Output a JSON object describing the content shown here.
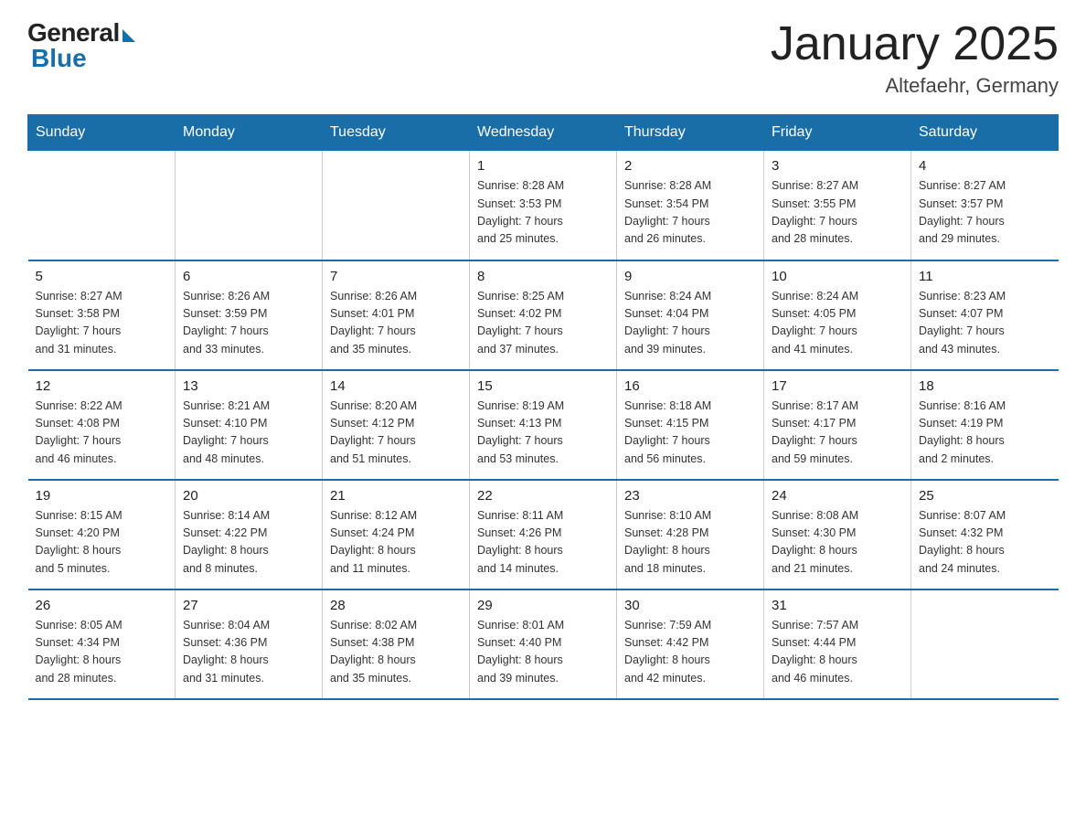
{
  "logo": {
    "general": "General",
    "blue": "Blue"
  },
  "title": "January 2025",
  "location": "Altefaehr, Germany",
  "weekdays": [
    "Sunday",
    "Monday",
    "Tuesday",
    "Wednesday",
    "Thursday",
    "Friday",
    "Saturday"
  ],
  "weeks": [
    [
      {
        "day": "",
        "info": ""
      },
      {
        "day": "",
        "info": ""
      },
      {
        "day": "",
        "info": ""
      },
      {
        "day": "1",
        "info": "Sunrise: 8:28 AM\nSunset: 3:53 PM\nDaylight: 7 hours\nand 25 minutes."
      },
      {
        "day": "2",
        "info": "Sunrise: 8:28 AM\nSunset: 3:54 PM\nDaylight: 7 hours\nand 26 minutes."
      },
      {
        "day": "3",
        "info": "Sunrise: 8:27 AM\nSunset: 3:55 PM\nDaylight: 7 hours\nand 28 minutes."
      },
      {
        "day": "4",
        "info": "Sunrise: 8:27 AM\nSunset: 3:57 PM\nDaylight: 7 hours\nand 29 minutes."
      }
    ],
    [
      {
        "day": "5",
        "info": "Sunrise: 8:27 AM\nSunset: 3:58 PM\nDaylight: 7 hours\nand 31 minutes."
      },
      {
        "day": "6",
        "info": "Sunrise: 8:26 AM\nSunset: 3:59 PM\nDaylight: 7 hours\nand 33 minutes."
      },
      {
        "day": "7",
        "info": "Sunrise: 8:26 AM\nSunset: 4:01 PM\nDaylight: 7 hours\nand 35 minutes."
      },
      {
        "day": "8",
        "info": "Sunrise: 8:25 AM\nSunset: 4:02 PM\nDaylight: 7 hours\nand 37 minutes."
      },
      {
        "day": "9",
        "info": "Sunrise: 8:24 AM\nSunset: 4:04 PM\nDaylight: 7 hours\nand 39 minutes."
      },
      {
        "day": "10",
        "info": "Sunrise: 8:24 AM\nSunset: 4:05 PM\nDaylight: 7 hours\nand 41 minutes."
      },
      {
        "day": "11",
        "info": "Sunrise: 8:23 AM\nSunset: 4:07 PM\nDaylight: 7 hours\nand 43 minutes."
      }
    ],
    [
      {
        "day": "12",
        "info": "Sunrise: 8:22 AM\nSunset: 4:08 PM\nDaylight: 7 hours\nand 46 minutes."
      },
      {
        "day": "13",
        "info": "Sunrise: 8:21 AM\nSunset: 4:10 PM\nDaylight: 7 hours\nand 48 minutes."
      },
      {
        "day": "14",
        "info": "Sunrise: 8:20 AM\nSunset: 4:12 PM\nDaylight: 7 hours\nand 51 minutes."
      },
      {
        "day": "15",
        "info": "Sunrise: 8:19 AM\nSunset: 4:13 PM\nDaylight: 7 hours\nand 53 minutes."
      },
      {
        "day": "16",
        "info": "Sunrise: 8:18 AM\nSunset: 4:15 PM\nDaylight: 7 hours\nand 56 minutes."
      },
      {
        "day": "17",
        "info": "Sunrise: 8:17 AM\nSunset: 4:17 PM\nDaylight: 7 hours\nand 59 minutes."
      },
      {
        "day": "18",
        "info": "Sunrise: 8:16 AM\nSunset: 4:19 PM\nDaylight: 8 hours\nand 2 minutes."
      }
    ],
    [
      {
        "day": "19",
        "info": "Sunrise: 8:15 AM\nSunset: 4:20 PM\nDaylight: 8 hours\nand 5 minutes."
      },
      {
        "day": "20",
        "info": "Sunrise: 8:14 AM\nSunset: 4:22 PM\nDaylight: 8 hours\nand 8 minutes."
      },
      {
        "day": "21",
        "info": "Sunrise: 8:12 AM\nSunset: 4:24 PM\nDaylight: 8 hours\nand 11 minutes."
      },
      {
        "day": "22",
        "info": "Sunrise: 8:11 AM\nSunset: 4:26 PM\nDaylight: 8 hours\nand 14 minutes."
      },
      {
        "day": "23",
        "info": "Sunrise: 8:10 AM\nSunset: 4:28 PM\nDaylight: 8 hours\nand 18 minutes."
      },
      {
        "day": "24",
        "info": "Sunrise: 8:08 AM\nSunset: 4:30 PM\nDaylight: 8 hours\nand 21 minutes."
      },
      {
        "day": "25",
        "info": "Sunrise: 8:07 AM\nSunset: 4:32 PM\nDaylight: 8 hours\nand 24 minutes."
      }
    ],
    [
      {
        "day": "26",
        "info": "Sunrise: 8:05 AM\nSunset: 4:34 PM\nDaylight: 8 hours\nand 28 minutes."
      },
      {
        "day": "27",
        "info": "Sunrise: 8:04 AM\nSunset: 4:36 PM\nDaylight: 8 hours\nand 31 minutes."
      },
      {
        "day": "28",
        "info": "Sunrise: 8:02 AM\nSunset: 4:38 PM\nDaylight: 8 hours\nand 35 minutes."
      },
      {
        "day": "29",
        "info": "Sunrise: 8:01 AM\nSunset: 4:40 PM\nDaylight: 8 hours\nand 39 minutes."
      },
      {
        "day": "30",
        "info": "Sunrise: 7:59 AM\nSunset: 4:42 PM\nDaylight: 8 hours\nand 42 minutes."
      },
      {
        "day": "31",
        "info": "Sunrise: 7:57 AM\nSunset: 4:44 PM\nDaylight: 8 hours\nand 46 minutes."
      },
      {
        "day": "",
        "info": ""
      }
    ]
  ]
}
